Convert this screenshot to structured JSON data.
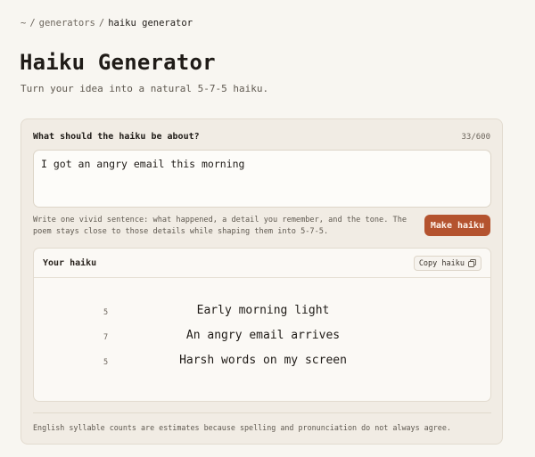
{
  "breadcrumb": {
    "root": "~",
    "parent": "generators",
    "current": "haiku generator",
    "separator": "/"
  },
  "page": {
    "title": "Haiku Generator",
    "subtitle": "Turn your idea into a natural 5-7-5 haiku."
  },
  "form": {
    "label": "What should the haiku be about?",
    "char_count": "33/600",
    "input_value": "I got an angry email this morning",
    "help_text": "Write one vivid sentence: what happened, a detail you remember, and the tone. The poem stays close to those details while shaping them into 5-7-5.",
    "submit_label": "Make haiku"
  },
  "output": {
    "title": "Your haiku",
    "copy_label": "Copy haiku",
    "copy_icon": "copy-icon",
    "lines": [
      {
        "syllables": "5",
        "text": "Early morning light"
      },
      {
        "syllables": "7",
        "text": "An angry email arrives"
      },
      {
        "syllables": "5",
        "text": "Harsh words on my screen"
      }
    ]
  },
  "footnote": "English syllable counts are estimates because spelling and pronunciation do not always agree.",
  "colors": {
    "accent": "#b4532f",
    "page_background": "#f8f6f1",
    "card_background": "#f1ece4"
  }
}
